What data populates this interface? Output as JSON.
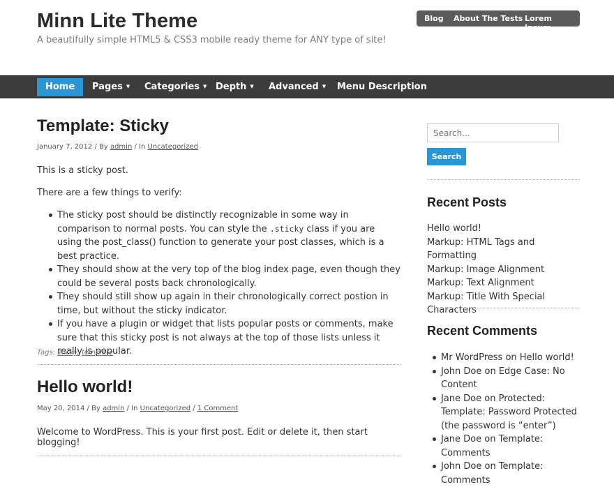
{
  "header": {
    "site_title": "Minn Lite Theme",
    "site_description": "A beautifully simple HTML5 & CSS3 mobile ready theme for ANY type of site!",
    "top_menu": [
      "Blog",
      "About The Tests",
      "Lorem Ipsum"
    ]
  },
  "nav": {
    "home": "Home",
    "pages": "Pages",
    "categories": "Categories",
    "depth": "Depth",
    "advanced": "Advanced",
    "menu_description": "Menu Description",
    "caret": "▼"
  },
  "posts": [
    {
      "title": "Template: Sticky",
      "date": "January 7, 2012",
      "by": " / By ",
      "author": "admin",
      "in": " / In ",
      "category": "Uncategorized",
      "paragraphs": [
        "This is a sticky post.",
        "There are a few things to verify:"
      ],
      "bullets": [
        {
          "pre": "The sticky post should be distinctly recognizable in some way in comparison to normal posts. You can style the ",
          "code": ".sticky",
          "post": " class if you are using the post_class() function to generate your post classes, which is a best practice."
        },
        {
          "text": "They should show at the very top of the blog index page, even though they could be several posts back chronologically."
        },
        {
          "text": "They should still show up again in their chronologically correct postion in time, but without the sticky indicator."
        },
        {
          "text": "If you have a plugin or widget that lists popular posts or comments, make sure that this sticky post is not always at the top of those lists unless it really is popular."
        }
      ],
      "tags_label": "Tags: ",
      "tags": [
        "sticky",
        "template"
      ],
      "tag_sep": ", "
    },
    {
      "title": "Hello world!",
      "date": "May 20, 2014",
      "by": " / By ",
      "author": "admin",
      "in": " / In ",
      "category": "Uncategorized",
      "sep": " / ",
      "comments": "1 Comment",
      "paragraphs": [
        "Welcome to WordPress. This is your first post. Edit or delete it, then start blogging!"
      ]
    }
  ],
  "sidebar": {
    "search_placeholder": "Search...",
    "search_button": "Search",
    "recent_posts_title": "Recent Posts",
    "recent_posts": [
      "Hello world!",
      "Markup: HTML Tags and Formatting",
      "Markup: Image Alignment",
      "Markup: Text Alignment",
      "Markup: Title With Special Characters"
    ],
    "recent_comments_title": "Recent Comments",
    "recent_comments": [
      "Mr WordPress on Hello world!",
      "John Doe on Edge Case: No Content",
      "Jane Doe on Protected: Template: Password Protected (the password is “enter”)",
      "Jane Doe on Template: Comments",
      "John Doe on Template: Comments"
    ]
  }
}
